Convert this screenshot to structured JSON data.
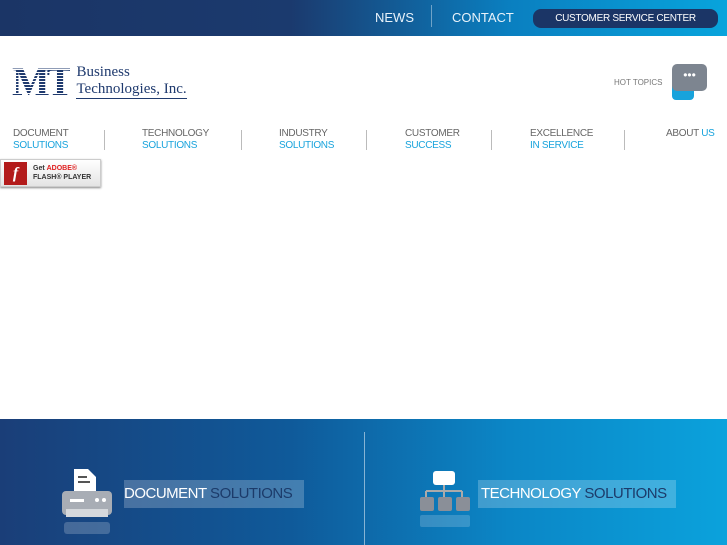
{
  "top": {
    "news": "NEWS",
    "contact": "CONTACT",
    "customer_service": "CUSTOMER SERVICE CENTER"
  },
  "logo": {
    "mark": "MT",
    "line1": "Business",
    "line2": "Technologies, Inc."
  },
  "hot_topics": {
    "label": "HOT TOPICS",
    "icon": "speech-bubble-icon"
  },
  "nav": [
    {
      "a": "DOCUMENT",
      "b": "SOLUTIONS"
    },
    {
      "a": "TECHNOLOGY",
      "b": "SOLUTIONS"
    },
    {
      "a": "INDUSTRY",
      "b": "SOLUTIONS"
    },
    {
      "a": "CUSTOMER",
      "b": "SUCCESS"
    },
    {
      "a": "EXCELLENCE",
      "b": "IN SERVICE"
    },
    {
      "a": "ABOUT",
      "b": "US"
    }
  ],
  "flash": {
    "get": "Get",
    "adobe": "ADOBE®",
    "player": "FLASH® PLAYER"
  },
  "panels": [
    {
      "w": "DOCUMENT",
      "d": " SOLUTIONS",
      "icon": "printer-icon"
    },
    {
      "w": "TECHNOLOGY",
      "d": " SOLUTIONS",
      "icon": "network-icon"
    }
  ]
}
